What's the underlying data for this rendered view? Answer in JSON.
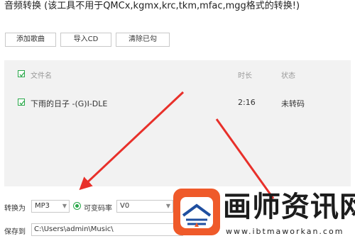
{
  "window": {
    "title": "音频转换 (该工具不用于QMCx,kgmx,krc,tkm,mfac,mgg格式的转换!)"
  },
  "toolbar": {
    "add_song": "添加歌曲",
    "import_cd": "导入CD",
    "clear_checked": "清除已勾"
  },
  "table": {
    "headers": {
      "name": "文件名",
      "duration": "时长",
      "status": "状态"
    },
    "rows": [
      {
        "checked": true,
        "name": "下雨的日子 -(G)I-DLE",
        "duration": "2:16",
        "status": "未转码"
      }
    ]
  },
  "convert": {
    "label": "转换为",
    "format": "MP3",
    "vbr_label": "可变码率",
    "vbr_selected": true,
    "quality": "V0"
  },
  "save": {
    "label": "保存到",
    "path": "C:\\Users\\admin\\Music\\"
  },
  "watermark": {
    "text": "画师资讯网",
    "url": "www.ibtmaworkan.com"
  },
  "colors": {
    "accent_green": "#2aa84a",
    "arrow_red": "#e8302a",
    "logo_orange": "#ef5a2a",
    "list_bg": "#f2f2f2"
  }
}
